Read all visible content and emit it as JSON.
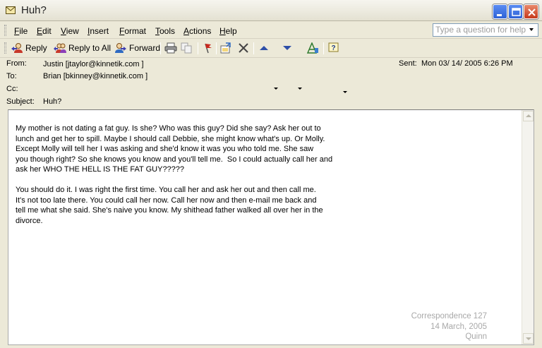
{
  "window": {
    "title": "Huh?"
  },
  "menu": {
    "items": [
      "File",
      "Edit",
      "View",
      "Insert",
      "Format",
      "Tools",
      "Actions",
      "Help"
    ],
    "ask_placeholder": "Type a question for help"
  },
  "toolbar": {
    "reply_label": "Reply",
    "reply_all_label": "Reply to All",
    "forward_label": "Forward"
  },
  "header": {
    "from_label": "From:",
    "from_value": "Justin [jtaylor@kinnetik.com ]",
    "to_label": "To:",
    "to_value": "Brian [bkinney@kinnetik.com ]",
    "cc_label": "Cc:",
    "cc_value": "",
    "subject_label": "Subject:",
    "subject_value": "Huh?",
    "sent_label": "Sent:",
    "sent_value": "Mon 03/ 14/ 2005  6:26 PM"
  },
  "message": {
    "paragraph_1": "My mother is not dating a fat guy. Is she? Who was this guy? Did she say? Ask her out to\nlunch and get her to spill. Maybe I should call Debbie, she might know what's up. Or Molly.\nExcept Molly will tell her I was asking and she'd know it was you who told me. She saw\nyou though right? So she knows you know and you'll tell me.  So I could actually call her and\nask her WHO THE HELL IS THE FAT GUY?????",
    "paragraph_2": "You should do it. I was right the first time. You call her and ask her out and then call me.\nIt's not too late there. You could call her now. Call her now and then e-mail me back and\ntell me what she said. She's naive you know. My shithead father walked all over her in the\ndivorce."
  },
  "caption": {
    "line_1": "Correspondence 127",
    "line_2": "14 March, 2005",
    "line_3": "Quinn"
  },
  "icons": {
    "title": "envelope-icon",
    "reply": "reply-icon",
    "reply_all": "reply-all-icon",
    "forward": "forward-icon",
    "print": "printer-icon",
    "copy": "copy-icon",
    "flag": "flag-icon",
    "move": "move-to-folder-icon",
    "delete": "delete-x-icon",
    "previous": "previous-item-icon",
    "next": "next-item-icon",
    "address_book": "address-book-icon",
    "help": "help-icon"
  },
  "colors": {
    "chrome": "#ece9d8",
    "close_button": "#c6391c",
    "window_buttons": "#2e62d6",
    "caption_text": "#a8a8a8"
  }
}
